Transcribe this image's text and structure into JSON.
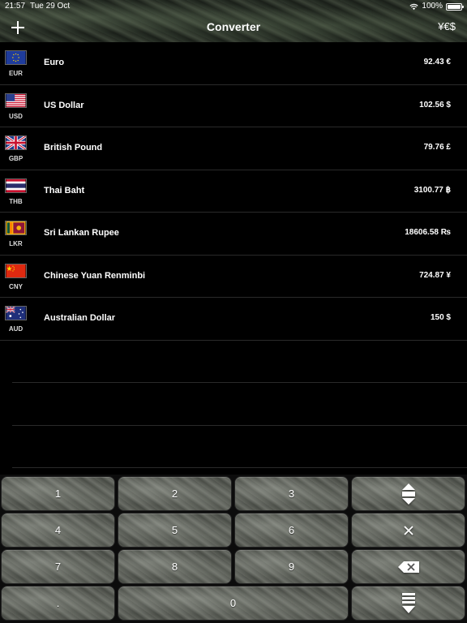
{
  "status_bar": {
    "time": "21:57",
    "date": "Tue 29 Oct",
    "battery": "100%"
  },
  "header": {
    "title": "Converter",
    "add_icon": "plus-icon",
    "currency_button_label": "¥€$"
  },
  "currencies": [
    {
      "code": "EUR",
      "name": "Euro",
      "amount": "92.43 €",
      "flag": "eu-flag-icon"
    },
    {
      "code": "USD",
      "name": "US Dollar",
      "amount": "102.56 $",
      "flag": "us-flag-icon"
    },
    {
      "code": "GBP",
      "name": "British Pound",
      "amount": "79.76 £",
      "flag": "gb-flag-icon"
    },
    {
      "code": "THB",
      "name": "Thai Baht",
      "amount": "3100.77 ฿",
      "flag": "th-flag-icon"
    },
    {
      "code": "LKR",
      "name": "Sri Lankan Rupee",
      "amount": "18606.58 ₨",
      "flag": "lk-flag-icon"
    },
    {
      "code": "CNY",
      "name": "Chinese Yuan Renminbi",
      "amount": "724.87 ¥",
      "flag": "cn-flag-icon"
    },
    {
      "code": "AUD",
      "name": "Australian Dollar",
      "amount": "150 $",
      "flag": "au-flag-icon"
    }
  ],
  "keypad": {
    "k1": "1",
    "k2": "2",
    "k3": "3",
    "k4": "4",
    "k5": "5",
    "k6": "6",
    "k7": "7",
    "k8": "8",
    "k9": "9",
    "kdot": ".",
    "k0": "0",
    "swap_icon": "swap-up-down-icon",
    "clear_icon": "multiply-icon",
    "backspace_icon": "backspace-icon",
    "hide_icon": "hide-keyboard-icon"
  },
  "colors": {
    "background": "#000000",
    "text": "#ffffff"
  }
}
